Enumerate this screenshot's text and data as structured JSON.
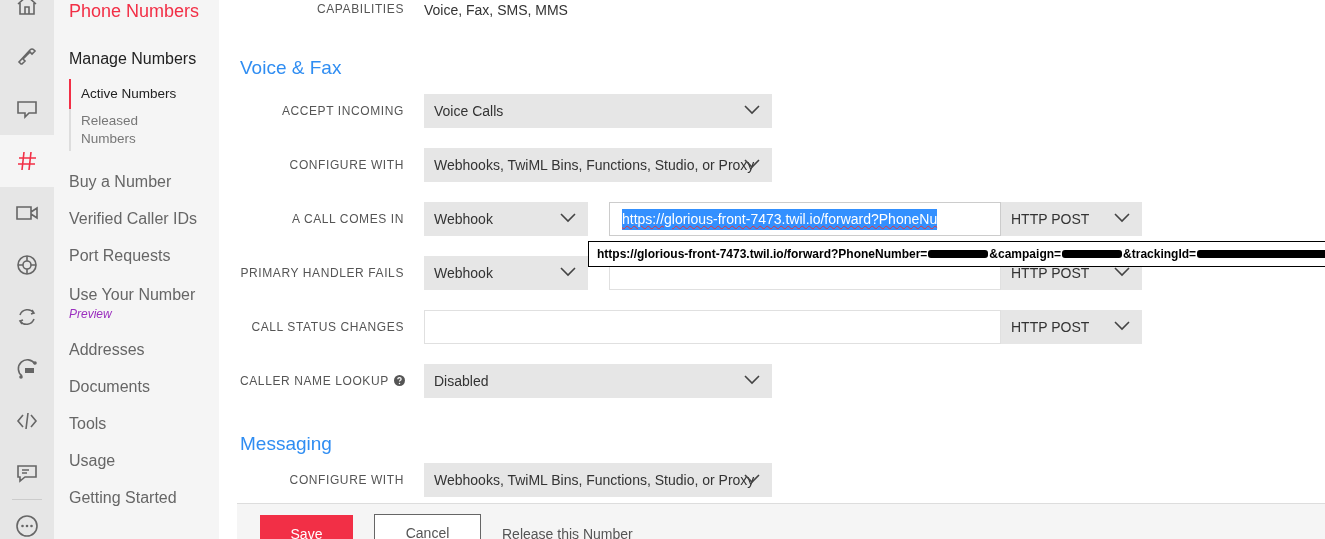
{
  "rail": [
    {
      "selected": false
    },
    {
      "selected": false
    },
    {
      "selected": false
    },
    {
      "selected": true
    },
    {
      "selected": false
    },
    {
      "selected": false
    },
    {
      "selected": false
    },
    {
      "selected": false
    },
    {
      "selected": false
    },
    {
      "selected": false
    },
    {
      "selected": false
    }
  ],
  "sidebar": {
    "title": "Phone Numbers",
    "section": "Manage Numbers",
    "subitems": [
      {
        "label": "Active Numbers",
        "selected": true
      },
      {
        "label": "Released Numbers",
        "selected": false
      }
    ],
    "items": [
      {
        "label": "Buy a Number"
      },
      {
        "label": "Verified Caller IDs"
      },
      {
        "label": "Port Requests"
      },
      {
        "label": "Use Your Number",
        "tag": "Preview"
      },
      {
        "label": "Addresses"
      },
      {
        "label": "Documents"
      },
      {
        "label": "Tools"
      },
      {
        "label": "Usage"
      },
      {
        "label": "Getting Started"
      }
    ]
  },
  "capabilities": {
    "label": "CAPABILITIES",
    "value": "Voice, Fax, SMS, MMS"
  },
  "sections": [
    {
      "title": "Voice & Fax",
      "rows": [
        {
          "label": "ACCEPT INCOMING",
          "controls": [
            {
              "kind": "select",
              "value": "Voice Calls"
            }
          ]
        },
        {
          "label": "CONFIGURE WITH",
          "controls": [
            {
              "kind": "select",
              "value": "Webhooks, TwiML Bins, Functions, Studio, or Proxy"
            }
          ]
        },
        {
          "label": "A CALL COMES IN",
          "controls": [
            {
              "kind": "handler",
              "value": "Webhook"
            },
            {
              "kind": "url",
              "value": "https://glorious-front-7473.twil.io/forward?PhoneNu",
              "selected": true
            },
            {
              "kind": "method",
              "value": "HTTP POST"
            }
          ]
        },
        {
          "label": "PRIMARY HANDLER FAILS",
          "controls": [
            {
              "kind": "handler",
              "value": "Webhook"
            },
            {
              "kind": "url",
              "selected": false
            },
            {
              "kind": "method",
              "value": "HTTP POST"
            }
          ]
        },
        {
          "label": "CALL STATUS CHANGES",
          "controls": [
            {
              "kind": "url",
              "selected": false
            },
            {
              "kind": "method",
              "value": "HTTP POST"
            }
          ]
        },
        {
          "label": "CALLER NAME LOOKUP",
          "help": true,
          "controls": [
            {
              "kind": "select",
              "value": "Disabled"
            }
          ]
        }
      ]
    },
    {
      "title": "Messaging",
      "rows": [
        {
          "label": "CONFIGURE WITH",
          "controls": [
            {
              "kind": "select",
              "value": "Webhooks, TwiML Bins, Functions, Studio, or Proxy"
            }
          ]
        }
      ]
    }
  ],
  "tooltip": {
    "parts": [
      {
        "kind": "text",
        "text": "https://glorious-front-7473.twil.io/forward?PhoneNumber="
      },
      {
        "kind": "redacted"
      },
      {
        "kind": "text",
        "text": "&campaign="
      },
      {
        "kind": "redacted"
      },
      {
        "kind": "text",
        "text": "&trackingId="
      },
      {
        "kind": "redacted"
      }
    ]
  },
  "footer": {
    "save": "Save",
    "cancel": "Cancel",
    "link": "Release this Number"
  }
}
